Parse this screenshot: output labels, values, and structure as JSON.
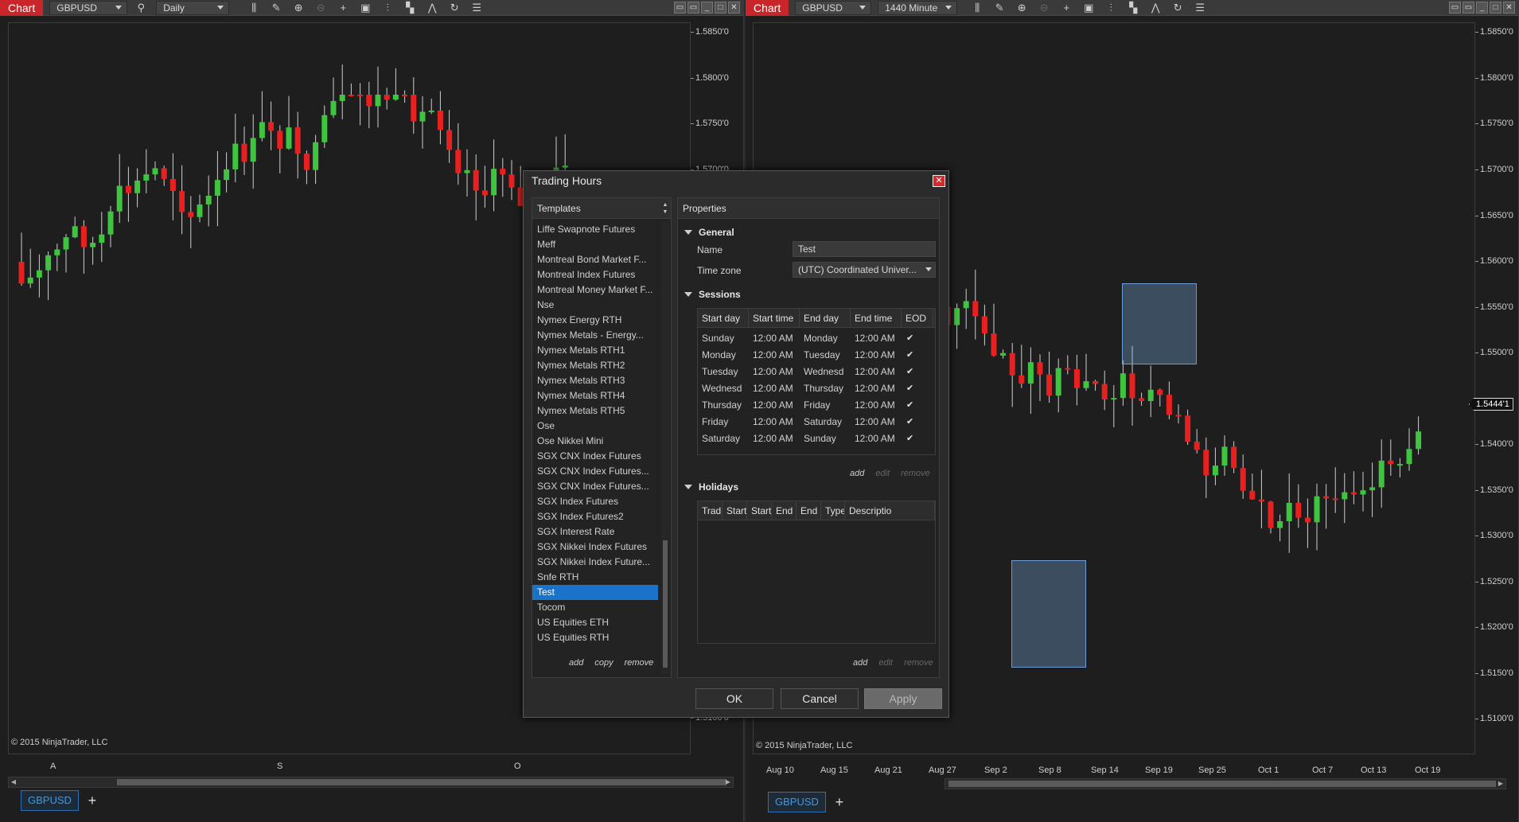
{
  "left_window": {
    "badge": "Chart",
    "instrument": "GBPUSD",
    "interval": "Daily",
    "y_ticks": [
      "1.5850'0",
      "1.5800'0",
      "1.5750'0",
      "1.5700'0",
      "1.5100'0"
    ],
    "x_ticks": [
      "A",
      "S",
      "O"
    ],
    "copyright": "© 2015 NinjaTrader, LLC",
    "tab": "GBPUSD"
  },
  "right_window": {
    "badge": "Chart",
    "instrument": "GBPUSD",
    "interval": "1440 Minute",
    "y_ticks": [
      "1.5850'0",
      "1.5800'0",
      "1.5750'0",
      "1.5700'0",
      "1.5650'0",
      "1.5600'0",
      "1.5550'0",
      "1.5500'0",
      "1.5400'0",
      "1.5350'0",
      "1.5300'0",
      "1.5250'0",
      "1.5200'0",
      "1.5150'0",
      "1.5100'0"
    ],
    "last_price": "1.5444'1",
    "x_ticks": [
      "Aug 10",
      "Aug 15",
      "Aug 21",
      "Aug 27",
      "Sep 2",
      "Sep 8",
      "Sep 14",
      "Sep 19",
      "Sep 25",
      "Oct 1",
      "Oct 7",
      "Oct 13",
      "Oct 19"
    ],
    "copyright": "© 2015 NinjaTrader, LLC",
    "tab": "GBPUSD"
  },
  "colors": {
    "up": "#3fc43f",
    "down": "#e8201f",
    "accent": "#c8262b",
    "selection": "#1a73c9"
  },
  "dialog": {
    "title": "Trading Hours",
    "templates_header": "Templates",
    "templates": [
      "Liffe Swapnote Futures",
      "Meff",
      "Montreal Bond Market F...",
      "Montreal Index Futures",
      "Montreal Money Market F...",
      "Nse",
      "Nymex Energy RTH",
      "Nymex Metals - Energy...",
      "Nymex Metals RTH1",
      "Nymex Metals RTH2",
      "Nymex Metals RTH3",
      "Nymex Metals RTH4",
      "Nymex Metals RTH5",
      "Ose",
      "Ose Nikkei Mini",
      "SGX CNX Index Futures",
      "SGX CNX Index Futures...",
      "SGX CNX Index Futures...",
      "SGX Index Futures",
      "SGX Index Futures2",
      "SGX Interest Rate",
      "SGX Nikkei Index Futures",
      "SGX Nikkei Index Future...",
      "Snfe RTH",
      "Test",
      "Tocom",
      "US Equities ETH",
      "US Equities RTH"
    ],
    "selected_template": "Test",
    "template_links": {
      "add": "add",
      "copy": "copy",
      "remove": "remove"
    },
    "properties_header": "Properties",
    "general_label": "General",
    "name_label": "Name",
    "name_value": "Test",
    "timezone_label": "Time zone",
    "timezone_value": "(UTC) Coordinated Univer...",
    "sessions_label": "Sessions",
    "session_columns": [
      "Start day",
      "Start time",
      "End day",
      "End time",
      "EOD"
    ],
    "sessions": [
      [
        "Sunday",
        "12:00 AM",
        "Monday",
        "12:00 AM"
      ],
      [
        "Monday",
        "12:00 AM",
        "Tuesday",
        "12:00 AM"
      ],
      [
        "Tuesday",
        "12:00 AM",
        "Wednesd",
        "12:00 AM"
      ],
      [
        "Wednesd",
        "12:00 AM",
        "Thursday",
        "12:00 AM"
      ],
      [
        "Thursday",
        "12:00 AM",
        "Friday",
        "12:00 AM"
      ],
      [
        "Friday",
        "12:00 AM",
        "Saturday",
        "12:00 AM"
      ],
      [
        "Saturday",
        "12:00 AM",
        "Sunday",
        "12:00 AM"
      ]
    ],
    "session_links": {
      "add": "add",
      "edit": "edit",
      "remove": "remove"
    },
    "holidays_label": "Holidays",
    "holiday_columns": [
      "Trad",
      "Start",
      "Start",
      "End",
      "End",
      "Type",
      "Descriptio"
    ],
    "holiday_links": {
      "add": "add",
      "edit": "edit",
      "remove": "remove"
    },
    "ok": "OK",
    "cancel": "Cancel",
    "apply": "Apply"
  }
}
